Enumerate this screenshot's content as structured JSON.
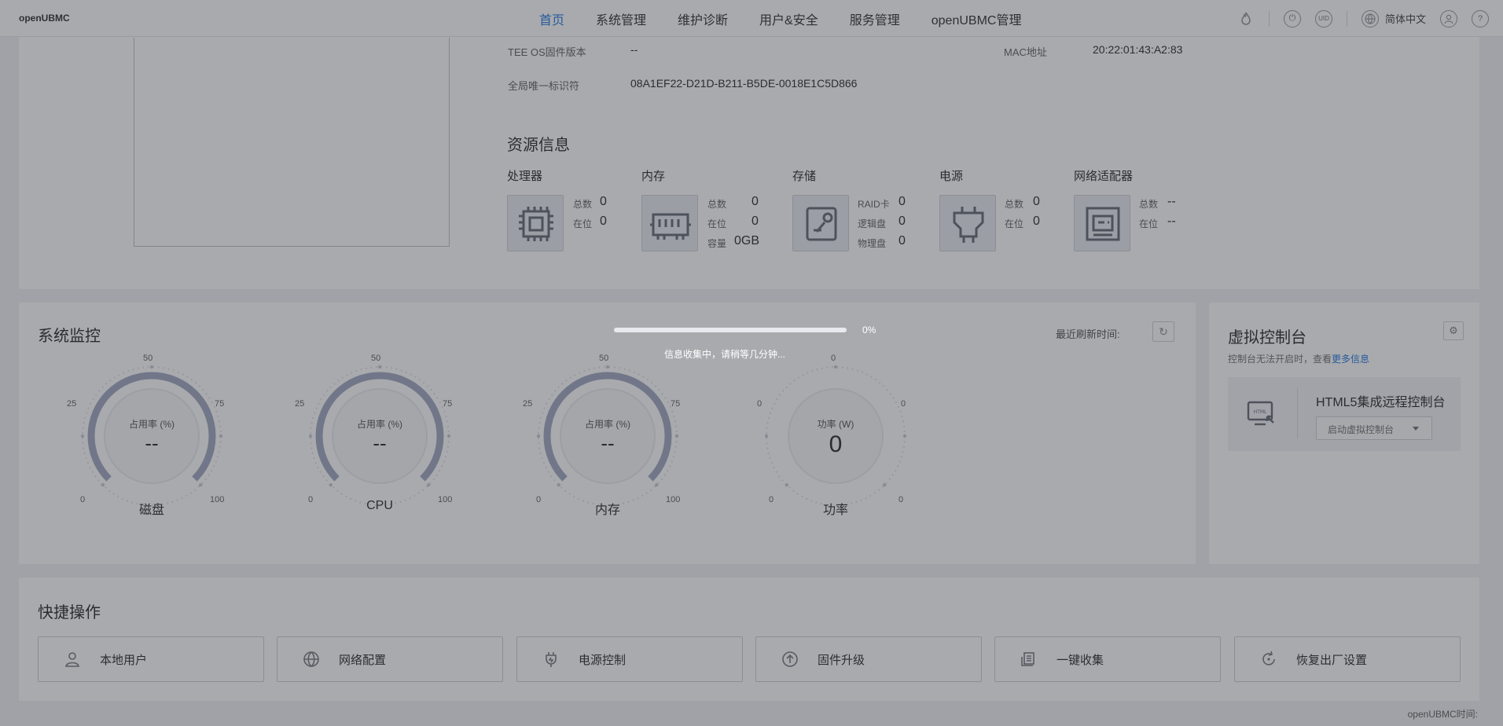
{
  "app": {
    "brand": "openUBMC"
  },
  "nav": {
    "items": [
      {
        "label": "首页",
        "active": true
      },
      {
        "label": "系统管理",
        "active": false
      },
      {
        "label": "维护诊断",
        "active": false
      },
      {
        "label": "用户&安全",
        "active": false
      },
      {
        "label": "服务管理",
        "active": false
      },
      {
        "label": "openUBMC管理",
        "active": false
      }
    ],
    "power_label": "⏻",
    "uid_label": "UID",
    "language": "简体中文",
    "help_label": "?"
  },
  "info": {
    "tee_label": "TEE OS固件版本",
    "tee_value": "--",
    "mac_label": "MAC地址",
    "mac_value": "20:22:01:43:A2:83",
    "guid_label": "全局唯一标识符",
    "guid_value": "08A1EF22-D21D-B211-B5DE-0018E1C5D866"
  },
  "resources": {
    "title": "资源信息",
    "processor": {
      "title": "处理器",
      "total_label": "总数",
      "total": "0",
      "present_label": "在位",
      "present": "0"
    },
    "memory": {
      "title": "内存",
      "total_label": "总数",
      "total": "0",
      "present_label": "在位",
      "present": "0",
      "capacity_label": "容量",
      "capacity": "0GB"
    },
    "storage": {
      "title": "存储",
      "raid_label": "RAID卡",
      "raid": "0",
      "logical_label": "逻辑盘",
      "logical": "0",
      "physical_label": "物理盘",
      "physical": "0"
    },
    "power": {
      "title": "电源",
      "total_label": "总数",
      "total": "0",
      "present_label": "在位",
      "present": "0"
    },
    "network": {
      "title": "网络适配器",
      "total_label": "总数",
      "total": "--",
      "present_label": "在位",
      "present": "--"
    }
  },
  "monitor": {
    "title": "系统监控",
    "refresh_label": "最近刷新时间:",
    "gauges": [
      {
        "name": "磁盘",
        "inner_label": "占用率 (%)",
        "value": "--",
        "ticks": [
          "0",
          "25",
          "50",
          "75",
          "100"
        ]
      },
      {
        "name": "CPU",
        "inner_label": "占用率 (%)",
        "value": "--",
        "ticks": [
          "0",
          "25",
          "50",
          "75",
          "100"
        ]
      },
      {
        "name": "内存",
        "inner_label": "占用率 (%)",
        "value": "--",
        "ticks": [
          "0",
          "25",
          "50",
          "75",
          "100"
        ]
      },
      {
        "name": "功率",
        "inner_label": "功率 (W)",
        "value": "0",
        "ticks": [
          "0",
          "0",
          "0",
          "0",
          "0"
        ]
      }
    ]
  },
  "virtual_console": {
    "title": "虚拟控制台",
    "note": "控制台无法开启时，查看",
    "more_link": "更多信息",
    "icon_text": "HTML",
    "name": "HTML5集成远程控制台",
    "launch_label": "启动虚拟控制台"
  },
  "quick": {
    "title": "快捷操作",
    "actions": [
      {
        "label": "本地用户",
        "icon": "user-icon"
      },
      {
        "label": "网络配置",
        "icon": "globe-icon"
      },
      {
        "label": "电源控制",
        "icon": "power-plug-icon"
      },
      {
        "label": "固件升级",
        "icon": "upload-icon"
      },
      {
        "label": "一键收集",
        "icon": "collect-icon"
      },
      {
        "label": "恢复出厂设置",
        "icon": "restore-icon"
      }
    ]
  },
  "footer": {
    "time_label": "openUBMC时间:"
  },
  "overlay": {
    "progress": 0.0,
    "percent": "0%",
    "message": "信息收集中，请稍等几分钟..."
  },
  "colors": {
    "accent": "#0f6fe0",
    "gauge_arc": "#9aa3bd",
    "overlay": "#40424a"
  }
}
